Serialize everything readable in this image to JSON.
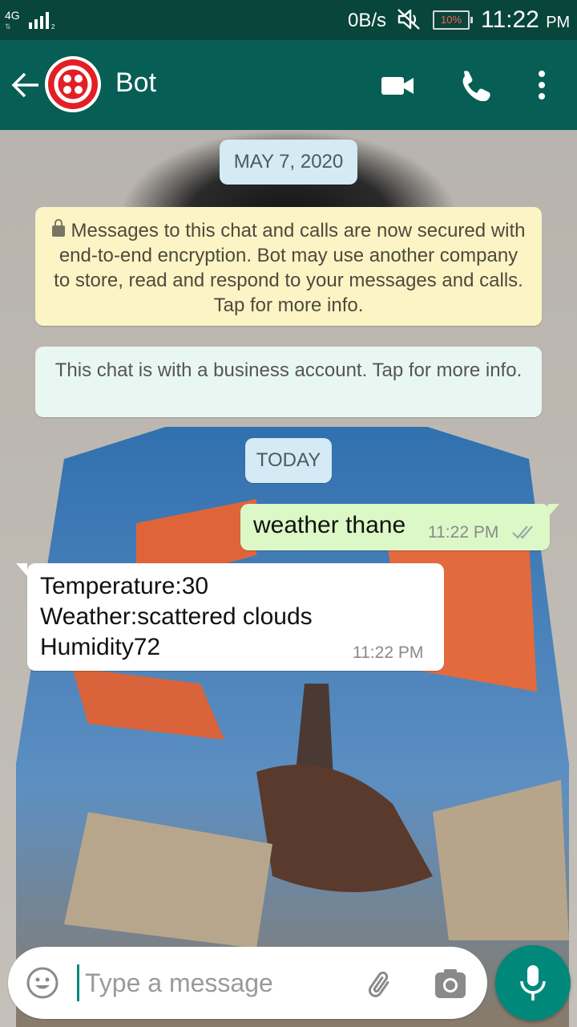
{
  "status_bar": {
    "network": "4G",
    "data_speed": "0B/s",
    "battery": "10%",
    "time": "11:22",
    "time_suffix": "PM"
  },
  "header": {
    "contact_name": "Bot",
    "brand_color": "#075e54",
    "avatar_color": "#e31e24",
    "icons": [
      "back-arrow-icon",
      "video-call-icon",
      "voice-call-icon",
      "more-options-icon"
    ]
  },
  "chat": {
    "date_first": "MAY 7, 2020",
    "encryption_notice": "Messages to this chat and calls are now secured with end-to-end encryption. Bot may use another company to store, read and respond to your messages and calls. Tap for more info.",
    "business_notice": "This chat is with a business account. Tap for more info.",
    "date_today": "TODAY",
    "messages": [
      {
        "direction": "outgoing",
        "text": "weather thane",
        "time": "11:22 PM",
        "status": "delivered-double-check"
      },
      {
        "direction": "incoming",
        "lines": [
          "Temperature:30",
          "Weather:scattered clouds",
          "Humidity72"
        ],
        "time": "11:22 PM"
      }
    ]
  },
  "composer": {
    "placeholder": "Type a message",
    "accent": "#00897b"
  }
}
